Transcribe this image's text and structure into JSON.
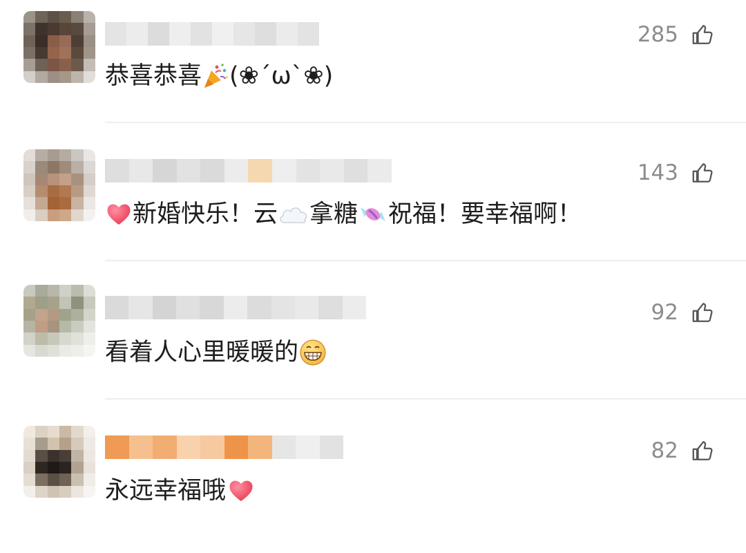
{
  "comments": [
    {
      "likes": "285",
      "text_parts": [
        "恭喜恭喜",
        "(❀´ω`❀)"
      ],
      "emoji": "party-popper"
    },
    {
      "likes": "143",
      "text_parts": [
        "新婚快乐！云",
        "拿糖",
        "祝福！要幸福啊！"
      ],
      "emoji": [
        "red-heart",
        "cloud",
        "candy"
      ]
    },
    {
      "likes": "92",
      "text_parts": [
        "看着人心里暖暖的"
      ],
      "emoji": "grinning-face"
    },
    {
      "likes": "82",
      "text_parts": [
        "永远幸福哦"
      ],
      "emoji": "red-heart"
    }
  ],
  "icons": {
    "like": "thumbs-up-outline-icon"
  },
  "colors": {
    "like_count": "#8c8c8c",
    "divider": "#eeeeee",
    "text": "#1e1e1e"
  }
}
